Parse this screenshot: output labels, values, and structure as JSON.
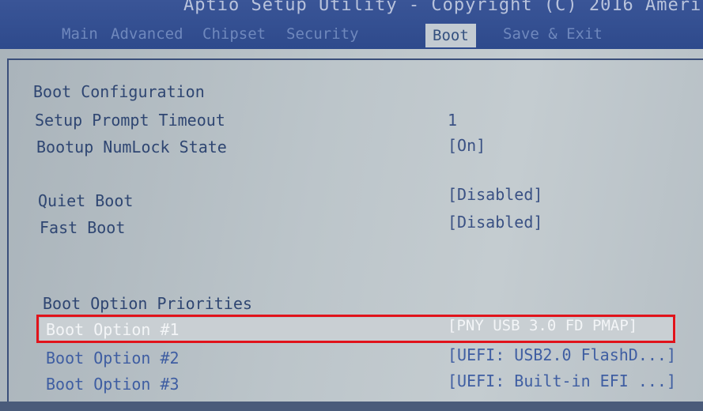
{
  "header": {
    "title": "Aptio Setup Utility - Copyright (C) 2016 Ameri",
    "tabs": [
      {
        "label": "Main"
      },
      {
        "label": "Advanced"
      },
      {
        "label": "Chipset"
      },
      {
        "label": "Security"
      },
      {
        "label": "Boot",
        "active": true
      },
      {
        "label": "Save & Exit"
      }
    ]
  },
  "boot": {
    "section_title": "Boot Configuration",
    "setup_prompt_timeout": {
      "label": "Setup Prompt Timeout",
      "value": "1"
    },
    "bootup_numlock_state": {
      "label": "Bootup NumLock State",
      "value": "[On]"
    },
    "quiet_boot": {
      "label": "Quiet Boot",
      "value": "[Disabled]"
    },
    "fast_boot": {
      "label": "Fast Boot",
      "value": "[Disabled]"
    },
    "priorities_title": "Boot Option Priorities",
    "options": [
      {
        "label": "Boot Option #1",
        "value": "[PNY USB 3.0 FD PMAP]",
        "selected": true
      },
      {
        "label": "Boot Option #2",
        "value": "[UEFI: USB2.0 FlashD...]"
      },
      {
        "label": "Boot Option #3",
        "value": "[UEFI: Built-in EFI ...]"
      }
    ]
  },
  "colors": {
    "header_bg": "#2e4a8c",
    "active_tab_bg": "#c3cbd2",
    "highlight_box": "#e1131b",
    "screen_bg": "#bcc5ca"
  }
}
